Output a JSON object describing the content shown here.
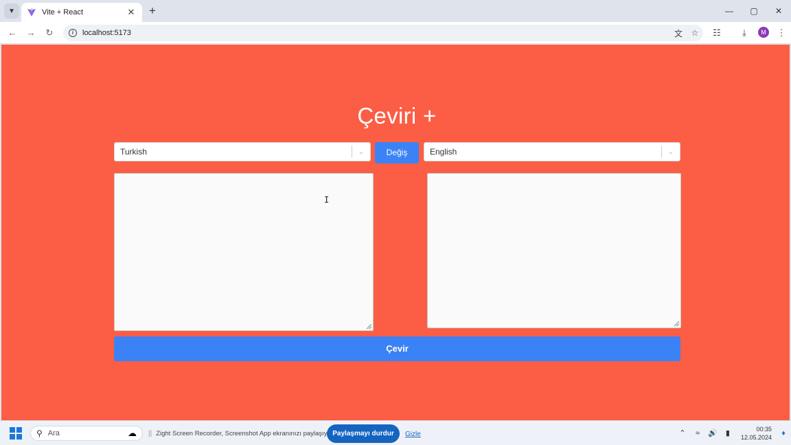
{
  "browser": {
    "tab_title": "Vite + React",
    "url": "localhost:5173",
    "profile_initial": "M",
    "icons": [
      "tab-search-icon",
      "vite-favicon",
      "close-icon",
      "new-tab-icon",
      "back-icon",
      "forward-icon",
      "reload-icon",
      "site-info-icon",
      "translate-icon",
      "bookmark-star-icon",
      "extensions-icon",
      "download-icon",
      "menu-icon"
    ]
  },
  "app": {
    "title": "Çeviri +",
    "source_language": "Turkish",
    "target_language": "English",
    "swap_label": "Değiş",
    "translate_label": "Çevir",
    "source_text": "",
    "target_text": "",
    "background_color": "#fb5e45",
    "button_color": "#3b82f6"
  },
  "taskbar": {
    "search_placeholder": "Ara",
    "share_message": "Zight Screen Recorder, Screenshot App ekranınızı paylaşıyor.",
    "stop_share_label": "Paylaşmayı durdur",
    "hide_label": "Gizle",
    "time": "00:35",
    "date": "12.05.2024"
  }
}
